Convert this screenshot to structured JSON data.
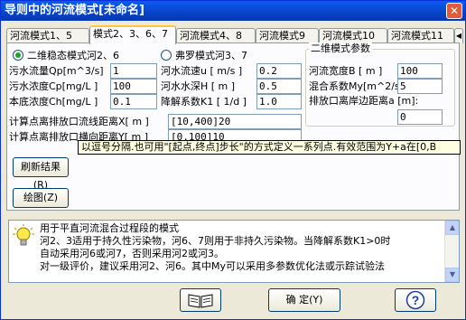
{
  "window": {
    "title": "导则中的河流模式[未命名]",
    "close_glyph": "✕"
  },
  "tabs": [
    "河流模式1、5",
    "模式2、3、6、7",
    "河流模式4、8",
    "河流模式9",
    "河流模式10",
    "河流模式11"
  ],
  "tab_arrow": "◀",
  "model_options": {
    "two_dim": "二维稳态模式河2、6",
    "fronte": "弗罗模式河3、7",
    "selected": "two_dim"
  },
  "left_fields": [
    {
      "label": "污水流量Qp[m^3/s]",
      "value": "1"
    },
    {
      "label": "污水浓度Cp[mg/L ]",
      "value": "100"
    },
    {
      "label": "本底浓度Ch[mg/L ]",
      "value": "0.1"
    }
  ],
  "mid_fields": [
    {
      "label": "河水流速u [ m/s ]",
      "value": "0.2"
    },
    {
      "label": "河水水深H [  m  ]",
      "value": "0.5"
    },
    {
      "label": "降解系数K1 [ 1/d ]",
      "value": "1.0"
    }
  ],
  "params_group": {
    "title": "二维模式参数",
    "fields": [
      {
        "label": "河流宽度B [  m  ]",
        "value": "100"
      },
      {
        "label": "混合系数My[m^2/s]",
        "value": "5"
      }
    ],
    "distance_label": "排放口离岸边距离a [m]:",
    "distance_value": "0"
  },
  "calc_fields": [
    {
      "label": "计算点离排放口流线距离X[ m ]",
      "value": "[10,400]20"
    },
    {
      "label": "计算点离排放口横向距离Y[ m ]",
      "value": "[0,100]10"
    }
  ],
  "tooltip": "以逗号分隔.也可用\"[起点,终点]步长\"的方式定义一系列点.有效范围为Y+a在[0,B",
  "buttons": {
    "refresh": "刷新结果(R)",
    "plot": "绘图(Z)",
    "ok": "确 定(Y)",
    "help_glyph": "?"
  },
  "help_text": [
    "用于平直河流混合过程段的模式",
    "    河2、3适用于持久性污染物，河6、7则用于非持久污染物。当降解系数K1>0时",
    "自动采用河6或河7，否则采用河2或河3。",
    "    对一级评价，建议采用河2、河6。其中My可以采用多参数优化法或示踪试验法"
  ],
  "scroll": {
    "up": "▲",
    "down": "▼"
  }
}
